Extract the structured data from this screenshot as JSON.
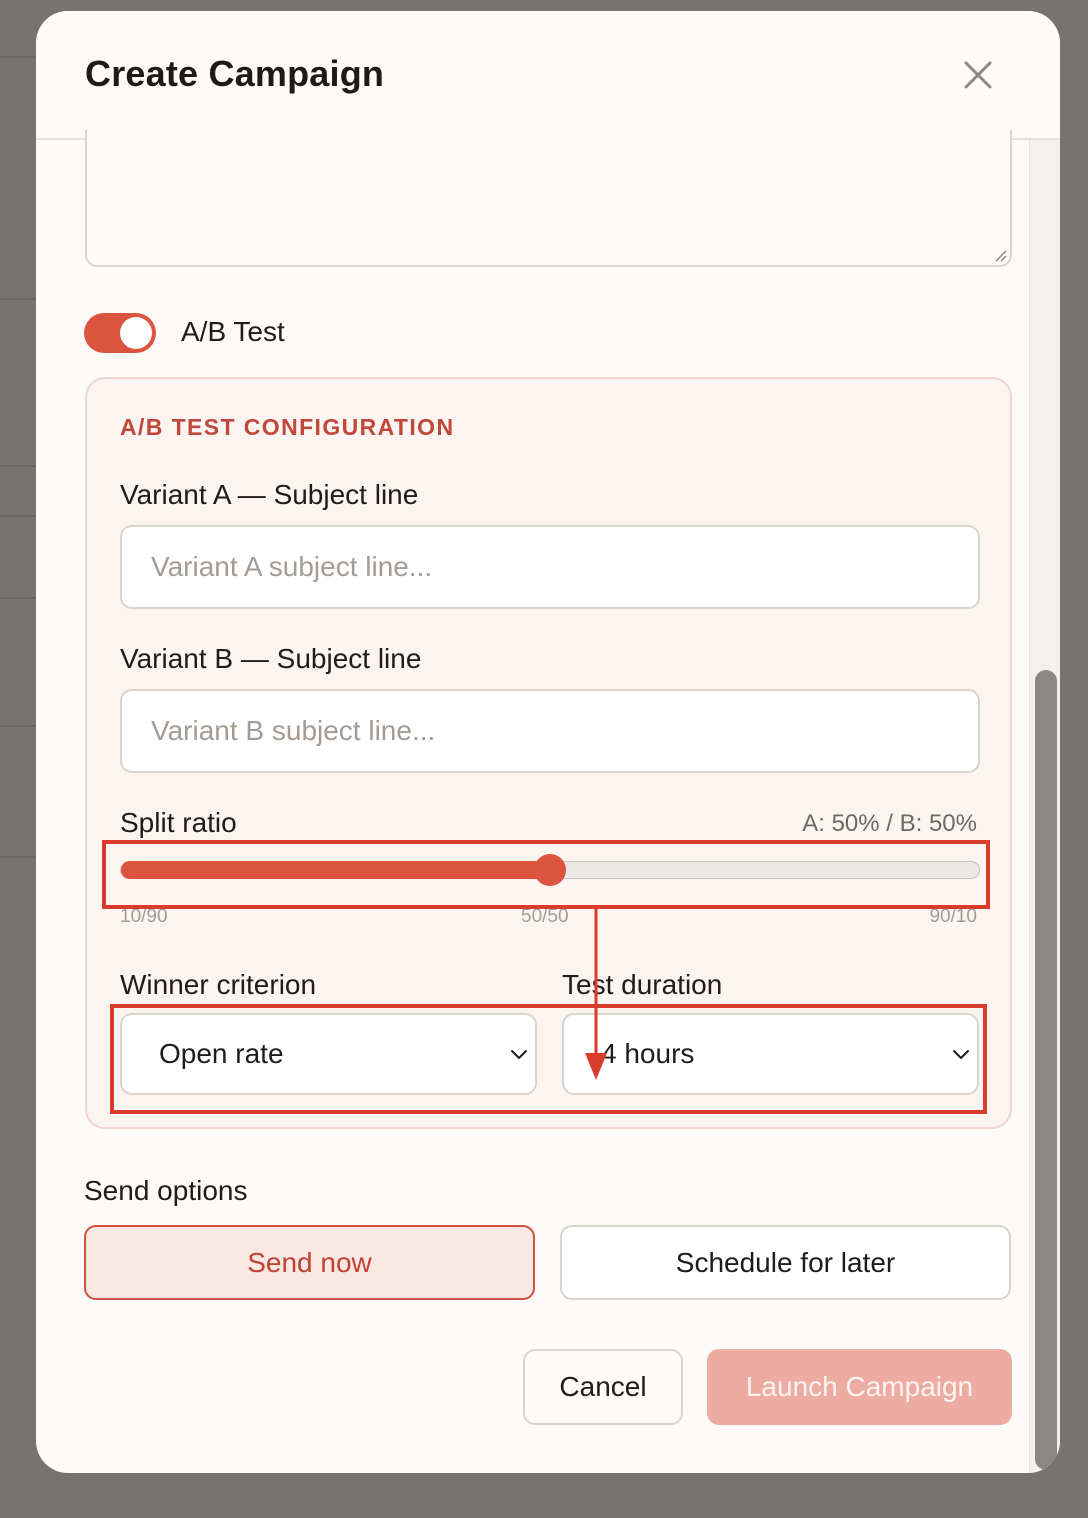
{
  "modal": {
    "title": "Create Campaign"
  },
  "ab_toggle": {
    "label": "A/B Test",
    "on": true
  },
  "ab_config": {
    "heading": "A/B TEST CONFIGURATION",
    "variant_a": {
      "label": "Variant A — Subject line",
      "placeholder": "Variant A subject line..."
    },
    "variant_b": {
      "label": "Variant B — Subject line",
      "placeholder": "Variant B subject line..."
    },
    "split": {
      "label": "Split ratio",
      "value_text": "A: 50% / B: 50%",
      "value_percent_a": 50,
      "min_pct": 10,
      "max_pct": 90,
      "ticks": [
        "10/90",
        "50/50",
        "90/10"
      ]
    },
    "winner": {
      "label": "Winner criterion",
      "value": "Open rate"
    },
    "duration": {
      "label": "Test duration",
      "value": "4 hours"
    }
  },
  "send_options": {
    "label": "Send options",
    "send_now": "Send now",
    "schedule": "Schedule for later",
    "selected": "send_now"
  },
  "footer": {
    "cancel": "Cancel",
    "launch": "Launch Campaign"
  },
  "colors": {
    "accent": "#dc5340",
    "annotation": "#d83c2d",
    "launch_disabled": "#ecaca2"
  },
  "icons": {
    "close": "close-icon",
    "chevron": "chevron-down-icon"
  }
}
